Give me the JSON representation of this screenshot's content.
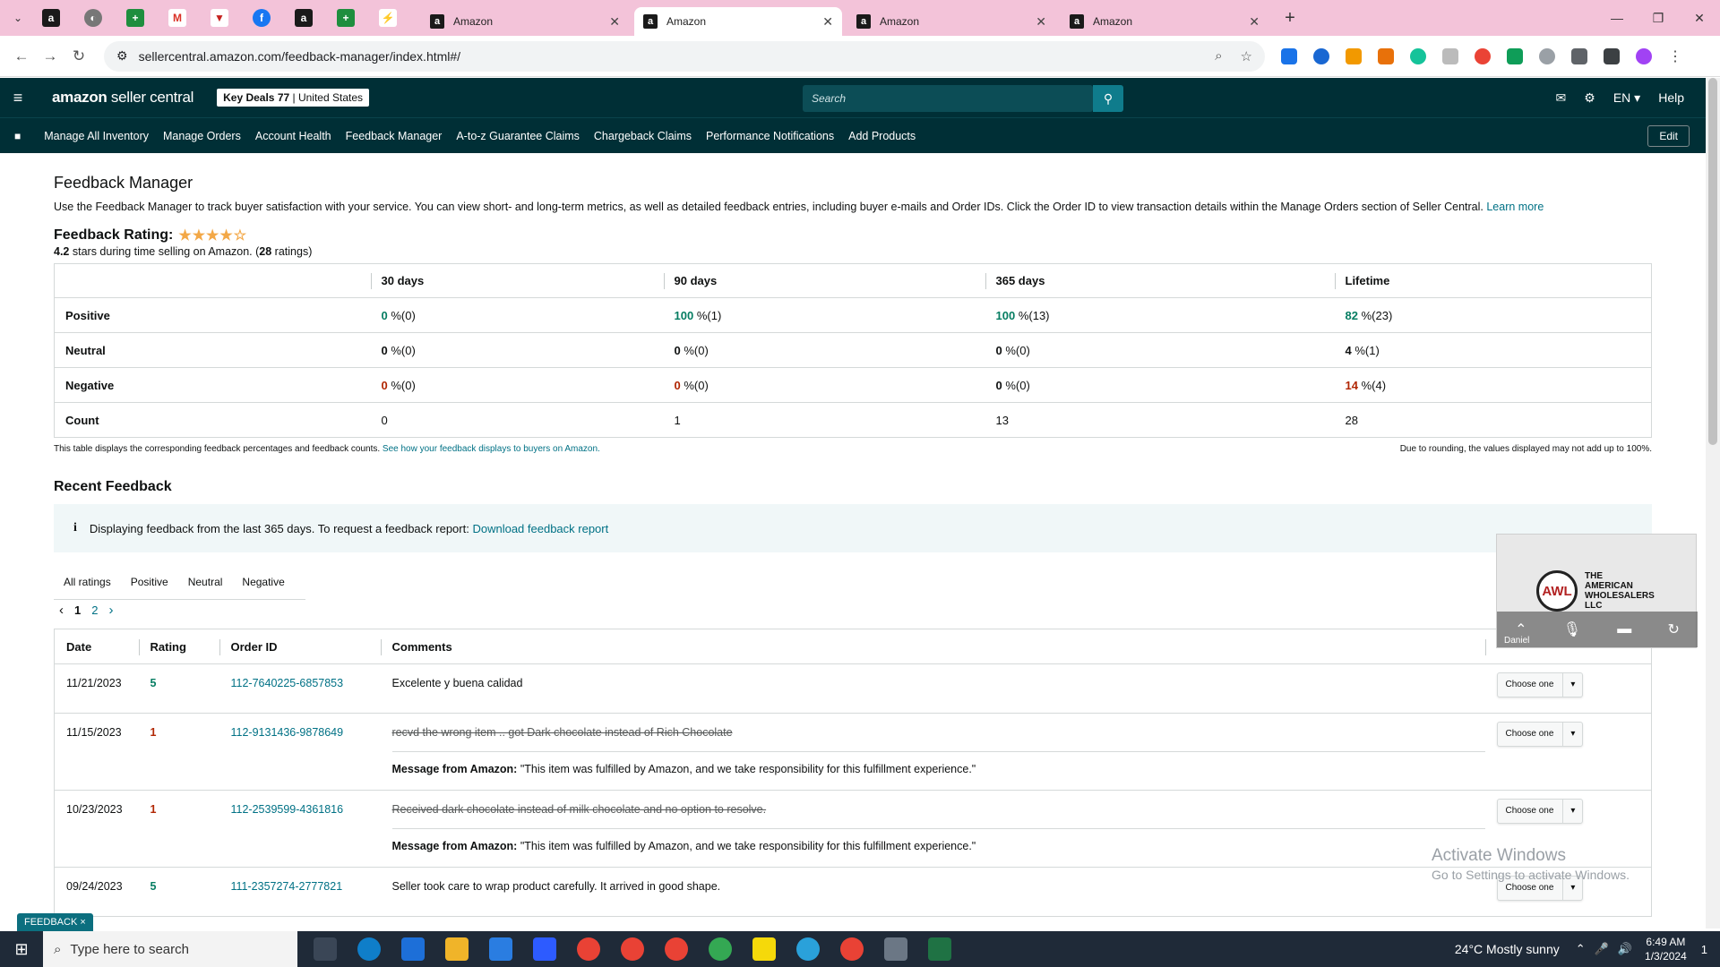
{
  "browser": {
    "tabs": [
      {
        "title": "Amazon",
        "active": false
      },
      {
        "title": "Amazon",
        "active": true
      },
      {
        "title": "Amazon",
        "active": false
      },
      {
        "title": "Amazon",
        "active": false
      }
    ],
    "url": "sellercentral.amazon.com/feedback-manager/index.html#/"
  },
  "header": {
    "logo_main": "amazon",
    "logo_sub": " seller central",
    "store_name": "Key Deals 77",
    "marketplace": "United States",
    "search_placeholder": "Search",
    "language": "EN ▾",
    "help": "Help"
  },
  "nav": {
    "items": [
      "Manage All Inventory",
      "Manage Orders",
      "Account Health",
      "Feedback Manager",
      "A-to-z Guarantee Claims",
      "Chargeback Claims",
      "Performance Notifications",
      "Add Products"
    ],
    "edit": "Edit"
  },
  "page": {
    "title": "Feedback Manager",
    "intro": "Use the Feedback Manager to track buyer satisfaction with your service. You can view short- and long-term metrics, as well as detailed feedback entries, including buyer e-mails and Order IDs. Click the Order ID to view transaction details within the Manage Orders section of Seller Central.",
    "learn_more": "Learn more",
    "rating_title": "Feedback Rating:",
    "rating_value": "4.2",
    "rating_mid": " stars during time selling on Amazon. (",
    "rating_count": "28",
    "rating_end": " ratings)",
    "stars_filled": 4,
    "stars_total": 5
  },
  "metrics": {
    "columns": [
      "30 days",
      "90 days",
      "365 days",
      "Lifetime"
    ],
    "rows": [
      {
        "label": "Positive",
        "cells": [
          {
            "pct": "0",
            "cnt": "%(0)"
          },
          {
            "pct": "100",
            "cnt": "%(1)"
          },
          {
            "pct": "100",
            "cnt": "%(13)"
          },
          {
            "pct": "82",
            "cnt": "%(23)"
          }
        ]
      },
      {
        "label": "Neutral",
        "cells": [
          {
            "pct": "0",
            "cnt": "%(0)"
          },
          {
            "pct": "0",
            "cnt": "%(0)"
          },
          {
            "pct": "0",
            "cnt": "%(0)"
          },
          {
            "pct": "4",
            "cnt": "%(1)"
          }
        ]
      },
      {
        "label": "Negative",
        "cells": [
          {
            "pct": "0",
            "cnt": "%(0)"
          },
          {
            "pct": "0",
            "cnt": "%(0)"
          },
          {
            "pct": "0",
            "cnt": "%(0)"
          },
          {
            "pct": "14",
            "cnt": "%(4)"
          }
        ]
      },
      {
        "label": "Count",
        "cells": [
          {
            "pct": "",
            "cnt": "0"
          },
          {
            "pct": "",
            "cnt": "1"
          },
          {
            "pct": "",
            "cnt": "13"
          },
          {
            "pct": "",
            "cnt": "28"
          }
        ]
      }
    ],
    "note_left": "This table displays the corresponding feedback percentages and feedback counts.",
    "note_link": "See how your feedback displays to buyers on Amazon.",
    "note_right": "Due to rounding, the values displayed may not add up to 100%."
  },
  "recent": {
    "title": "Recent Feedback",
    "info_text": "Displaying feedback from the last 365 days. To request a feedback report:",
    "info_link": "Download feedback report",
    "filter_tabs": [
      "All ratings",
      "Positive",
      "Neutral",
      "Negative"
    ],
    "pages": [
      "1",
      "2"
    ],
    "columns": [
      "Date",
      "Rating",
      "Order ID",
      "Comments"
    ],
    "choose_label": "Choose one",
    "amazon_msg_label": "Message from Amazon:",
    "rows": [
      {
        "date": "11/21/2023",
        "rating": "5",
        "order": "112-7640225-6857853",
        "comment": "Excelente y buena calidad",
        "struck": false,
        "amazon_msg": ""
      },
      {
        "date": "11/15/2023",
        "rating": "1",
        "order": "112-9131436-9878649",
        "comment": "recvd the wrong item .. got Dark chocolate instead of Rich Chocolate",
        "struck": true,
        "amazon_msg": "\"This item was fulfilled by Amazon, and we take responsibility for this fulfillment experience.\""
      },
      {
        "date": "10/23/2023",
        "rating": "1",
        "order": "112-2539599-4361816",
        "comment": "Received dark chocolate instead of milk chocolate and no option to resolve.",
        "struck": true,
        "amazon_msg": "\"This item was fulfilled by Amazon, and we take responsibility for this fulfillment experience.\""
      },
      {
        "date": "09/24/2023",
        "rating": "5",
        "order": "111-2357274-2777821",
        "comment": "Seller took care to wrap product carefully. It arrived in good shape.",
        "struck": false,
        "amazon_msg": ""
      }
    ]
  },
  "video_widget": {
    "logo_letters": "AWL",
    "brand_lines": [
      "THE",
      "AMERICAN",
      "WHOLESALERS",
      "LLC"
    ],
    "participant": "Daniel"
  },
  "watermark": {
    "line1": "Activate Windows",
    "line2": "Go to Settings to activate Windows."
  },
  "feedback_badge": "FEEDBACK ×",
  "taskbar": {
    "search_placeholder": "Type here to search",
    "weather": "24°C  Mostly sunny",
    "time": "6:49 AM",
    "date": "1/3/2024",
    "notifications": "1"
  },
  "colors": {
    "amazon_header": "#002f36",
    "link": "#007185",
    "positive": "#067d62",
    "negative": "#b12704",
    "tabstrip": "#f3c3d9"
  }
}
